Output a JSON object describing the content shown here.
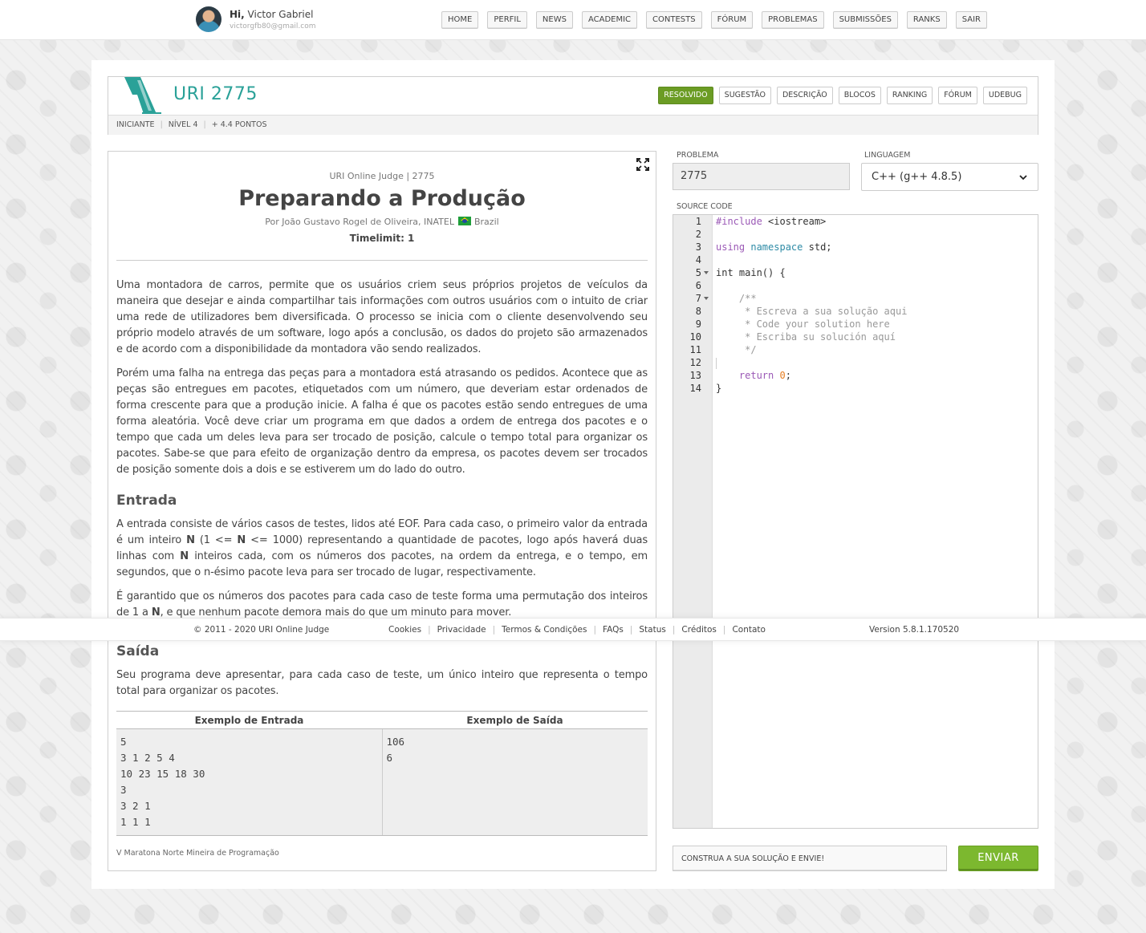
{
  "user": {
    "greeting": "Hi,",
    "name": "Victor Gabriel",
    "email": "victorgfb80@gmail.com"
  },
  "nav": [
    "HOME",
    "PERFIL",
    "NEWS",
    "ACADEMIC",
    "CONTESTS",
    "FÓRUM",
    "PROBLEMAS",
    "SUBMISSÕES",
    "RANKS",
    "SAIR"
  ],
  "problem": {
    "title": "URI 2775",
    "tabs": [
      "RESOLVIDO",
      "SUGESTÃO",
      "DESCRIÇÃO",
      "BLOCOS",
      "RANKING",
      "FÓRUM",
      "UDEBUG"
    ],
    "level_label": "INICIANTE",
    "level": "NÍVEL 4",
    "points": "+ 4.4 PONTOS"
  },
  "statement": {
    "origin": "URI Online Judge | 2775",
    "title": "Preparando a Produção",
    "author": "Por João Gustavo Rogel de Oliveira, INATEL",
    "country": "Brazil",
    "timelimit": "Timelimit: 1",
    "p1": "Uma montadora de carros, permite que os usuários criem seus próprios projetos de veículos da maneira que desejar e ainda compartilhar tais informações com outros usuários com o intuito de criar uma rede de utilizadores bem diversificada. O processo se inicia com o cliente desenvolvendo seu próprio modelo através de um software, logo após a conclusão, os dados do projeto são armazenados e de acordo com a disponibilidade da montadora vão sendo realizados.",
    "p2": "Porém uma falha na entrega das peças para a montadora está atrasando os pedidos. Acontece que as peças são entregues em pacotes, etiquetados com um número, que deveriam estar ordenados de forma crescente para que a produção inicie. A falha é que os pacotes estão sendo entregues de uma forma aleatória. Você deve criar um programa em que dados a ordem de entrega dos pacotes e o tempo que cada um deles leva para ser trocado de posição, calcule o tempo total para organizar os pacotes. Sabe-se que para efeito de organização dentro da empresa, os pacotes devem ser trocados de posição somente dois a dois e se estiverem um do lado do outro.",
    "input_heading": "Entrada",
    "input_p1": {
      "a": "A entrada consiste de vários casos de testes, lidos até EOF. Para cada caso, o primeiro valor da entrada é um inteiro ",
      "b": "N",
      "c": " (1 <= ",
      "d": "N",
      "e": " <= 1000) representando a quantidade de pacotes, logo após haverá duas linhas com ",
      "f": "N",
      "g": " inteiros cada, com os números dos pacotes, na ordem da entrega, e o tempo, em segundos, que o n-ésimo pacote leva para ser trocado de lugar, respectivamente."
    },
    "input_p2": {
      "a": "É garantido que os números dos pacotes para cada caso de teste forma uma permutação dos inteiros de 1 a ",
      "b": "N",
      "c": ", e que nenhum pacote demora mais do que um minuto para mover."
    },
    "output_heading": "Saída",
    "output_p": "Seu programa deve apresentar, para cada caso de teste, um único inteiro que representa o tempo total para organizar os pacotes.",
    "example_input_header": "Exemplo de Entrada",
    "example_output_header": "Exemplo de Saída",
    "example_input": "5\n3 1 2 5 4\n10 23 15 18 30\n3\n3 2 1\n1 1 1",
    "example_output": "106\n6",
    "source": "V Maratona Norte Mineira de Programação"
  },
  "form": {
    "problem_label": "PROBLEMA",
    "problem_value": "2775",
    "language_label": "LINGUAGEM",
    "language_value": "C++ (g++ 4.8.5)",
    "source_label": "SOURCE CODE",
    "submit_hint": "CONSTRUA A SUA SOLUÇÃO E ENVIE!",
    "send_label": "ENVIAR"
  },
  "code": {
    "line_numbers": [
      "1",
      "2",
      "3",
      "4",
      "5",
      "6",
      "7",
      "8",
      "9",
      "10",
      "11",
      "12",
      "13",
      "14"
    ],
    "l1_kw": "#include",
    "l1_rest": " <iostream>",
    "l3_kw": "using",
    "l3_kw2": "namespace",
    "l3_rest": " std;",
    "l5": "int main() {",
    "l7": "    /**",
    "l8": "     * Escreva a sua solução aqui",
    "l9": "     * Code your solution here",
    "l10": "     * Escriba su solución aquí",
    "l11": "     */",
    "l13_kw": "return",
    "l13_num": "0",
    "l13_end": ";",
    "l14": "}"
  },
  "footer": {
    "copyright": "© 2011 - 2020 URI Online Judge",
    "links": [
      "Cookies",
      "Privacidade",
      "Termos & Condições",
      "FAQs",
      "Status",
      "Créditos",
      "Contato"
    ],
    "version": "Version 5.8.1.170520"
  },
  "colors": {
    "accent": "#2aa198",
    "resolved": "#6b9c24",
    "send": "#7cb82f"
  }
}
